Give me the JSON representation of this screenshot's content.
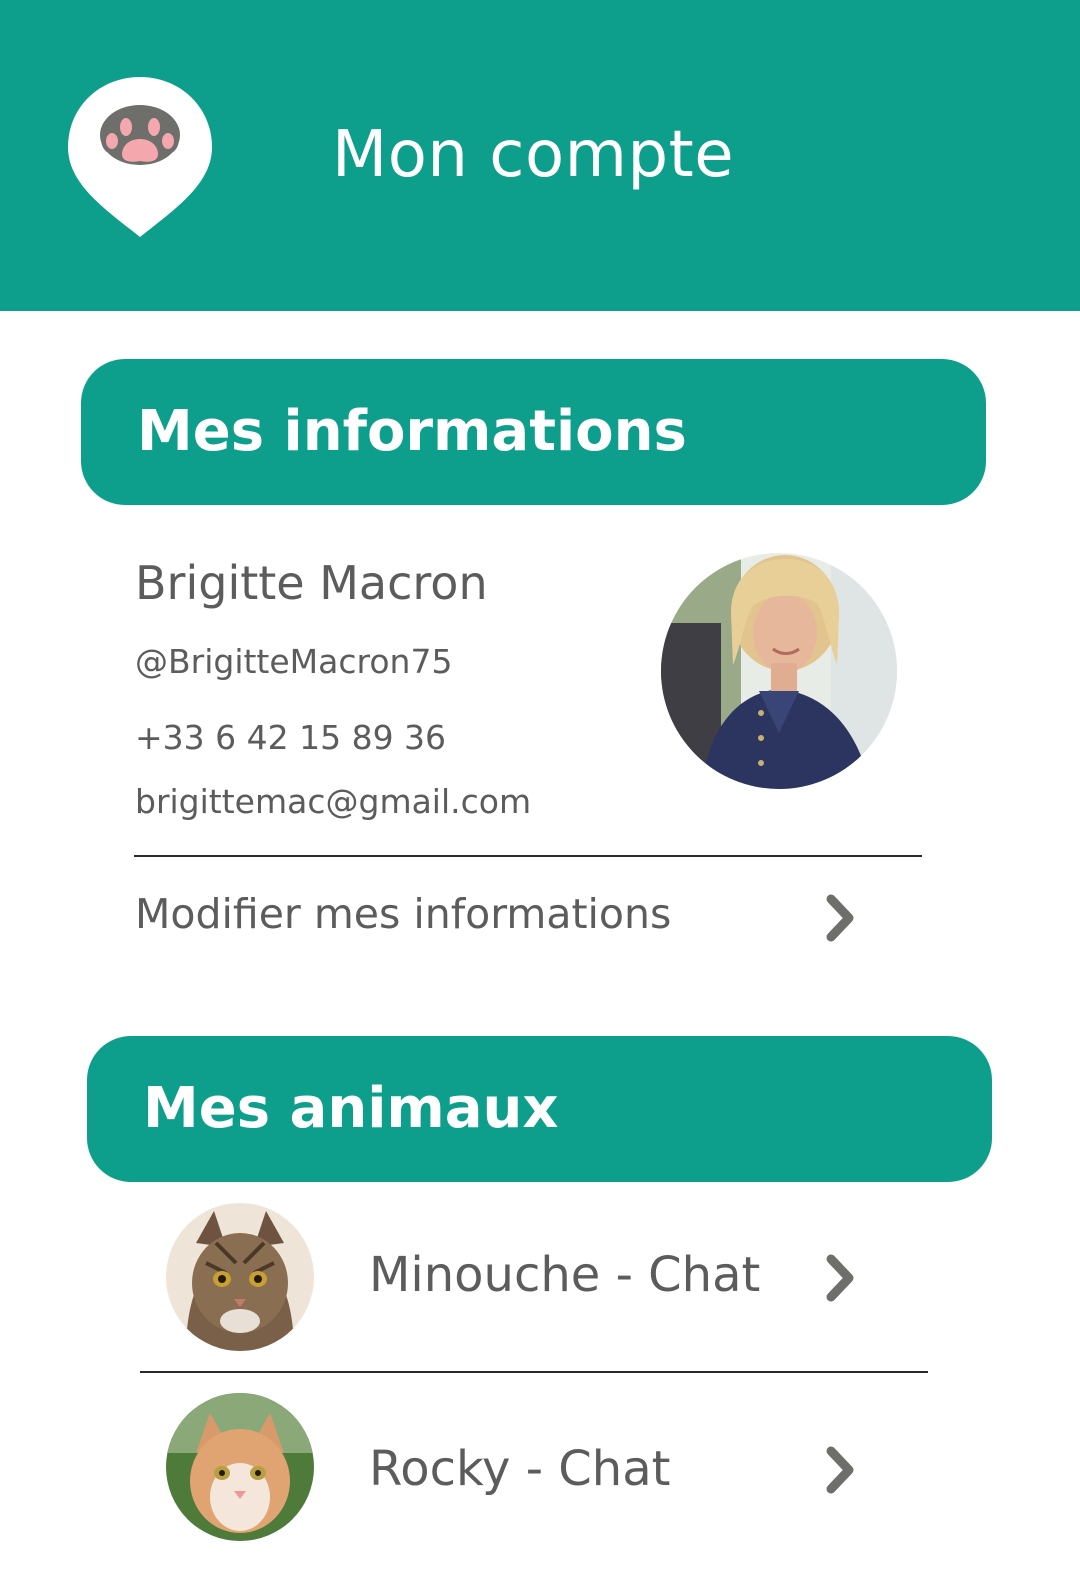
{
  "header": {
    "title": "Mon compte",
    "accent_color": "#0e9e8c",
    "logo_icon": "paw-location-pin-icon"
  },
  "info_section": {
    "title": "Mes informations",
    "name": "Brigitte Macron",
    "username": "@BrigitteMacron75",
    "phone": "+33 6 42 15 89 36",
    "email": "brigittemac@gmail.com",
    "edit_label": "Modifier mes informations",
    "chevron_icon": "chevron-right-icon"
  },
  "pets_section": {
    "title": "Mes animaux",
    "pets": [
      {
        "label": "Minouche - Chat"
      },
      {
        "label": "Rocky - Chat"
      }
    ]
  }
}
